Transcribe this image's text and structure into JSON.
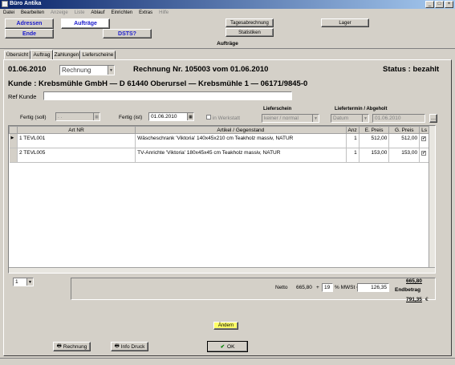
{
  "window": {
    "title": "Büro Antika"
  },
  "menu": [
    "Datei",
    "Bearbeiten",
    "Anzeige",
    "Liste",
    "Ablauf",
    "Einrichten",
    "Extras",
    "Hilfe"
  ],
  "menu_disabled": [
    false,
    false,
    true,
    true,
    false,
    false,
    false,
    true
  ],
  "nav": {
    "adressen": "Adressen",
    "auftraege": "Aufträge",
    "ende": "Ende",
    "dsts": "DSTS?",
    "tagesabrechnung": "Tagesabrechnung",
    "statistiken": "Statistiken",
    "lager": "Lager"
  },
  "section_title": "Aufträge",
  "tabs": [
    "Übersicht",
    "Auftrag",
    "Zahlungen",
    "Lieferscheine"
  ],
  "active_tab": 1,
  "header": {
    "date": "01.06.2010",
    "doc_type": "Rechnung",
    "invoice": "Rechnung Nr. 105003 vom 01.06.2010",
    "status": "Status : bezahlt",
    "customer": "Kunde :   Krebsmühle GmbH  — D 61440 Oberursel — Krebsmühle 1 — 06171/9845-0",
    "ref_label": "Ref Kunde",
    "ref_value": ""
  },
  "fields": {
    "fertig_soll_label": "Fertig (soll)",
    "fertig_soll_value": ". .",
    "fertig_ist_label": "Fertig (ist)",
    "fertig_ist_value": "01.06.2010",
    "werkstatt_label": "in Werkstatt",
    "lieferschein_label": "Lieferschein",
    "lieferschein_value": "keiner / normal",
    "liefertermin_label": "Liefertermin / Abgeholt",
    "liefertermin_type": "Datum",
    "liefertermin_value": "01.06.2010"
  },
  "table": {
    "columns": [
      "Art NR",
      "Artikel / Gegenstand",
      "Anz",
      "E. Preis",
      "G. Preis",
      "Ls"
    ],
    "rows": [
      {
        "no": "1",
        "art": "TEVL001",
        "desc": "Wäscheschrank 'Viktoria' 140x45x210 cm Teakholz massiv, NATUR",
        "anz": "1",
        "epreis": "512,00",
        "gpreis": "512,00",
        "ls": "✔"
      },
      {
        "no": "2",
        "art": "TEVL005",
        "desc": "TV-Anrichte 'Viktoria' 180x45x45 cm Teakholz massiv, NATUR",
        "anz": "1",
        "epreis": "153,00",
        "gpreis": "153,00",
        "ls": "✔"
      }
    ]
  },
  "footer": {
    "page_select": "1",
    "netto_label": "Netto",
    "netto_value": "665,80",
    "plus": "+",
    "mwst_rate": "19",
    "mwst_label": "% MWSt =",
    "mwst_value": "126,35",
    "sum_value": "665,80",
    "endbetrag_label": "Endbetrag",
    "endbetrag_value": "791,35",
    "currency": "€"
  },
  "buttons": {
    "aendern": "Ändern",
    "rechnung": "Rechnung",
    "info_druck": "Info Druck",
    "ok": "OK"
  },
  "colors": {
    "title_start": "#0a246a",
    "title_end": "#a6caf0",
    "nav_text": "#1a1acc",
    "aendern_bg": "#ffff66",
    "window_bg": "#d4d0c8"
  }
}
